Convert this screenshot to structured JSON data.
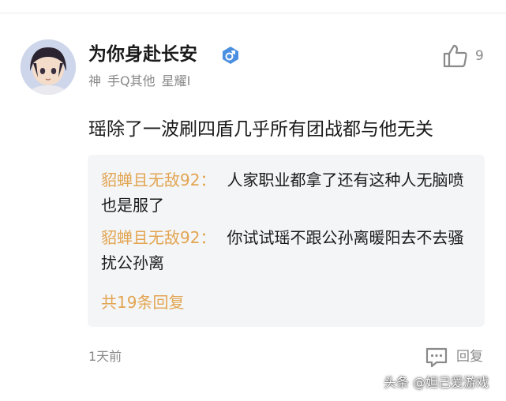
{
  "comment": {
    "user": {
      "name": "为你身赴长安",
      "meta": [
        "神",
        "手Q其他",
        "星耀I"
      ]
    },
    "likes": "9",
    "text": "瑶除了一波刷四盾几乎所有团战都与他无关",
    "replies": [
      {
        "author": "貂蝉且无敌92",
        "separator": "：",
        "text": "人家职业都拿了还有这种人无脑喷也是服了"
      },
      {
        "author": "貂蝉且无敌92",
        "separator": "：",
        "text": "你试试瑶不跟公孙离暖阳去不去骚扰公孙离"
      }
    ],
    "reply_count_label": "共19条回复",
    "time": "1天前",
    "reply_button_label": "回复"
  },
  "watermark": "头条 @妲己爱游戏",
  "icons": {
    "gender": "male-gender-icon",
    "like": "thumbs-up-icon",
    "reply": "comment-bubble-icon"
  },
  "colors": {
    "accent": "#e2a552",
    "gender_badge": "#4a8fe0",
    "muted": "#8a8a8a",
    "reply_bg": "#f4f5f7"
  }
}
